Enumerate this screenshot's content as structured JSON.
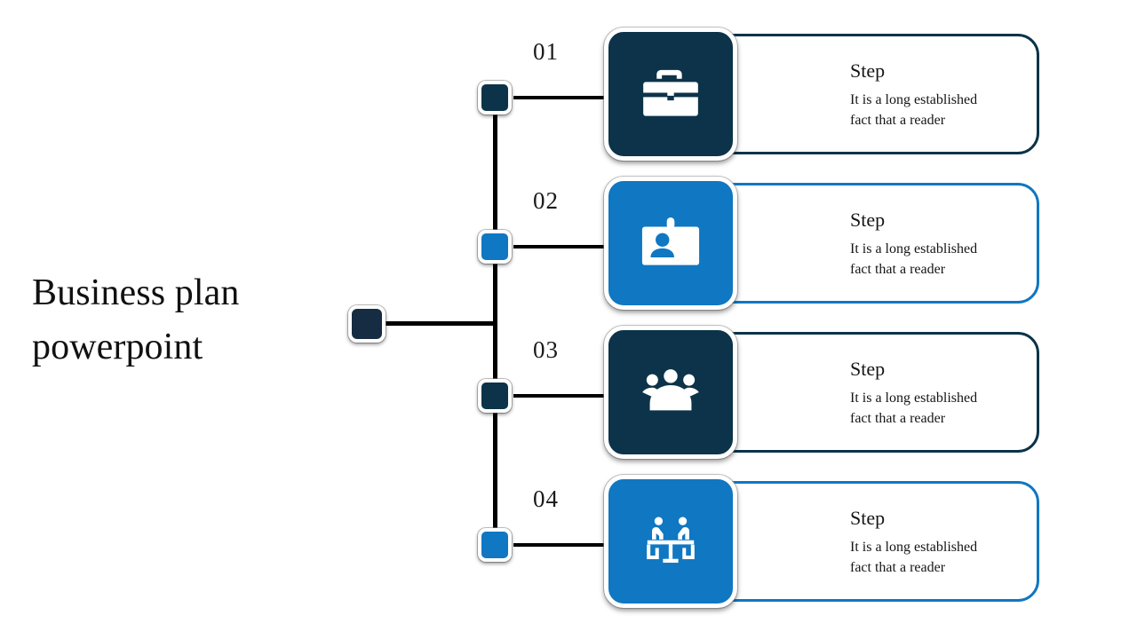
{
  "slide": {
    "title_line1": "Business plan",
    "title_line2": "powerpoint",
    "background": "#ffffff"
  },
  "colors": {
    "dark": "#0c3349",
    "blue": "#1077c2",
    "node_dark": "#152c42",
    "line": "#000000",
    "text": "#151515"
  },
  "steps": [
    {
      "number": "01",
      "title": "Step",
      "description": "It is a long established fact that a reader",
      "desc_line1": "It is a long established",
      "desc_line2": "fact that a reader",
      "icon": "briefcase-icon",
      "color": "#0c3349",
      "theme": "dark"
    },
    {
      "number": "02",
      "title": "Step",
      "description": "It is a long established fact that a reader",
      "desc_line1": "It is a long established",
      "desc_line2": "fact that a reader",
      "icon": "id-badge-icon",
      "color": "#1077c2",
      "theme": "blue"
    },
    {
      "number": "03",
      "title": "Step",
      "description": "It is a long established fact that a reader",
      "desc_line1": "It is a long established",
      "desc_line2": "fact that a reader",
      "icon": "group-people-icon",
      "color": "#0c3349",
      "theme": "dark"
    },
    {
      "number": "04",
      "title": "Step",
      "description": "It is a long established fact that a reader",
      "desc_line1": "It is a long established",
      "desc_line2": "fact that a reader",
      "icon": "meeting-table-icon",
      "color": "#1077c2",
      "theme": "blue"
    }
  ],
  "nodes": {
    "root_color": "#152c42",
    "branch_colors": [
      "#0c3349",
      "#1077c2",
      "#0c3349",
      "#1077c2"
    ]
  }
}
